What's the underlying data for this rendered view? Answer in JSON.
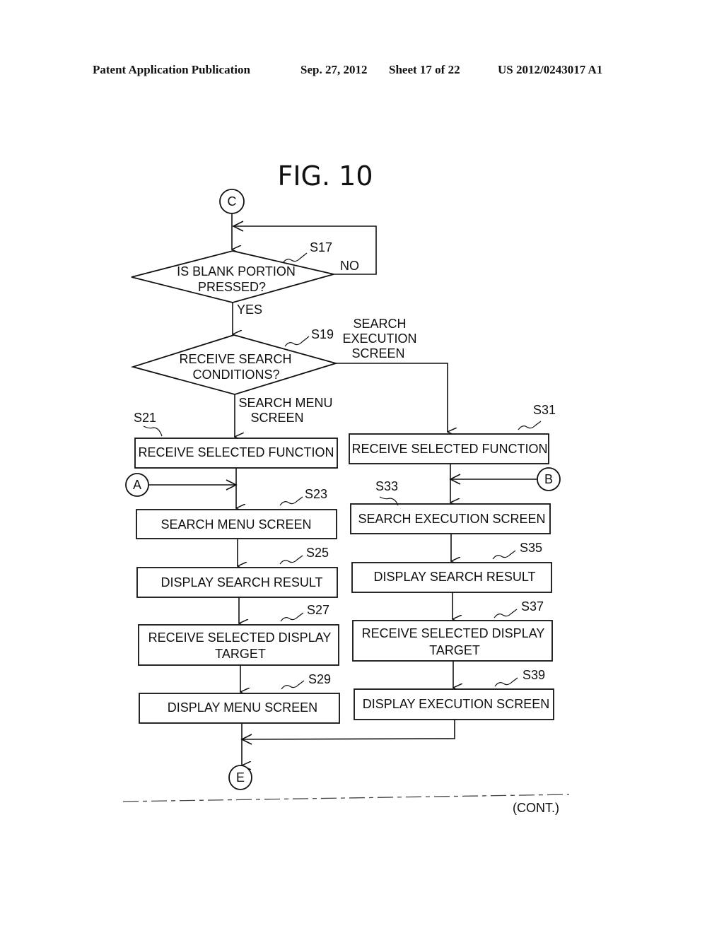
{
  "header": {
    "publication": "Patent Application Publication",
    "date": "Sep. 27, 2012",
    "sheet": "Sheet 17 of 22",
    "number": "US 2012/0243017 A1"
  },
  "figure": {
    "title": "FIG. 10",
    "connectors": {
      "c": "C",
      "a": "A",
      "b": "B",
      "e": "E"
    },
    "decisions": {
      "s17": {
        "step": "S17",
        "line1": "IS BLANK PORTION",
        "line2": "PRESSED?",
        "no": "NO",
        "yes": "YES"
      },
      "s19": {
        "step": "S19",
        "line1": "RECEIVE SEARCH",
        "line2": "CONDITIONS?",
        "right_branch": [
          "SEARCH",
          "EXECUTION",
          "SCREEN"
        ],
        "down_branch": [
          "SEARCH MENU",
          "SCREEN"
        ]
      }
    },
    "left_column": [
      {
        "step": "S21",
        "lines": [
          "RECEIVE SELECTED FUNCTION"
        ]
      },
      {
        "step": "S23",
        "lines": [
          "SEARCH MENU SCREEN"
        ]
      },
      {
        "step": "S25",
        "lines": [
          "DISPLAY SEARCH RESULT"
        ]
      },
      {
        "step": "S27",
        "lines": [
          "RECEIVE SELECTED DISPLAY",
          "TARGET"
        ]
      },
      {
        "step": "S29",
        "lines": [
          "DISPLAY MENU SCREEN"
        ]
      }
    ],
    "right_column": [
      {
        "step": "S31",
        "lines": [
          "RECEIVE SELECTED FUNCTION"
        ]
      },
      {
        "step": "S33",
        "lines": [
          "SEARCH EXECUTION SCREEN"
        ]
      },
      {
        "step": "S35",
        "lines": [
          "DISPLAY SEARCH RESULT"
        ]
      },
      {
        "step": "S37",
        "lines": [
          "RECEIVE SELECTED DISPLAY",
          "TARGET"
        ]
      },
      {
        "step": "S39",
        "lines": [
          "DISPLAY EXECUTION SCREEN"
        ]
      }
    ],
    "continuation": "(CONT.)"
  }
}
